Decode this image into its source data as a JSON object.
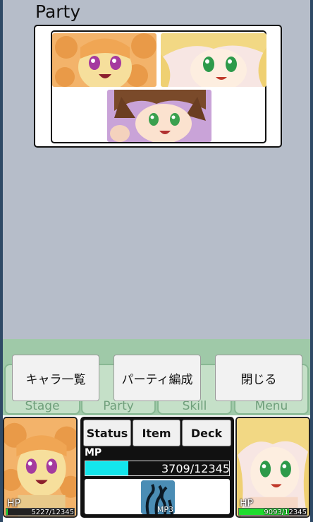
{
  "party": {
    "title": "Party",
    "members": [
      {
        "name": "orange-hair-girl"
      },
      {
        "name": "blonde-hair-girl"
      },
      {
        "name": "brown-hair-girl"
      }
    ]
  },
  "menu": {
    "buttons": {
      "character_list": "キャラ一覧",
      "party_formation": "パーティ編成",
      "close": "閉じる"
    },
    "tabs": [
      "Stage",
      "Party",
      "Skill",
      "Menu"
    ]
  },
  "hud": {
    "left": {
      "hp_label": "HP",
      "hp_text": "5227/12345",
      "hp_fraction": 0.02
    },
    "right": {
      "hp_label": "HP",
      "hp_text": "9093/12345",
      "hp_fraction": 0.74
    },
    "buttons": {
      "status": "Status",
      "item": "Item",
      "deck": "Deck"
    },
    "mp": {
      "label": "MP",
      "text": "3709/12345",
      "fraction": 0.3
    },
    "card": {
      "label": "MP3"
    }
  },
  "colors": {
    "background": "#b6bdc9",
    "menu_band": "#9fc9a8",
    "hp": "#1fdc2e",
    "mp": "#13e6ec"
  }
}
